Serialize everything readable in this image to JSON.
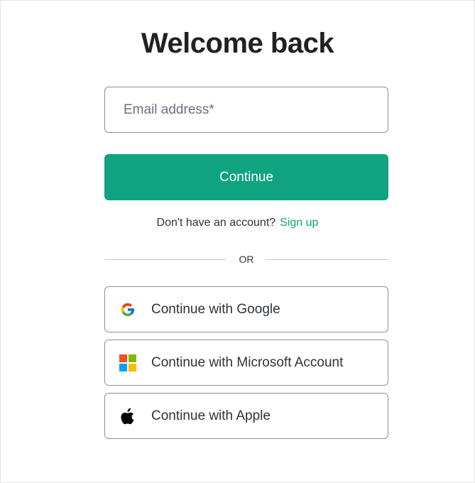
{
  "page": {
    "title": "Welcome back"
  },
  "email": {
    "placeholder": "Email address*",
    "value": ""
  },
  "continue_button": {
    "label": "Continue"
  },
  "signup": {
    "prompt": "Don't have an account?",
    "link_label": "Sign up"
  },
  "divider": {
    "label": "OR"
  },
  "social": {
    "google": {
      "label": "Continue with Google",
      "icon": "google-logo-icon"
    },
    "microsoft": {
      "label": "Continue with Microsoft Account",
      "icon": "microsoft-logo-icon"
    },
    "apple": {
      "label": "Continue with Apple",
      "icon": "apple-logo-icon"
    }
  },
  "colors": {
    "accent": "#10a37f",
    "title_text": "#202123",
    "body_text": "#2d333a",
    "border": "#8e8ea0",
    "divider": "#c2c8d0",
    "microsoft_red": "#f25022",
    "microsoft_green": "#7fba00",
    "microsoft_blue": "#00a4ef",
    "microsoft_yellow": "#ffb900"
  }
}
